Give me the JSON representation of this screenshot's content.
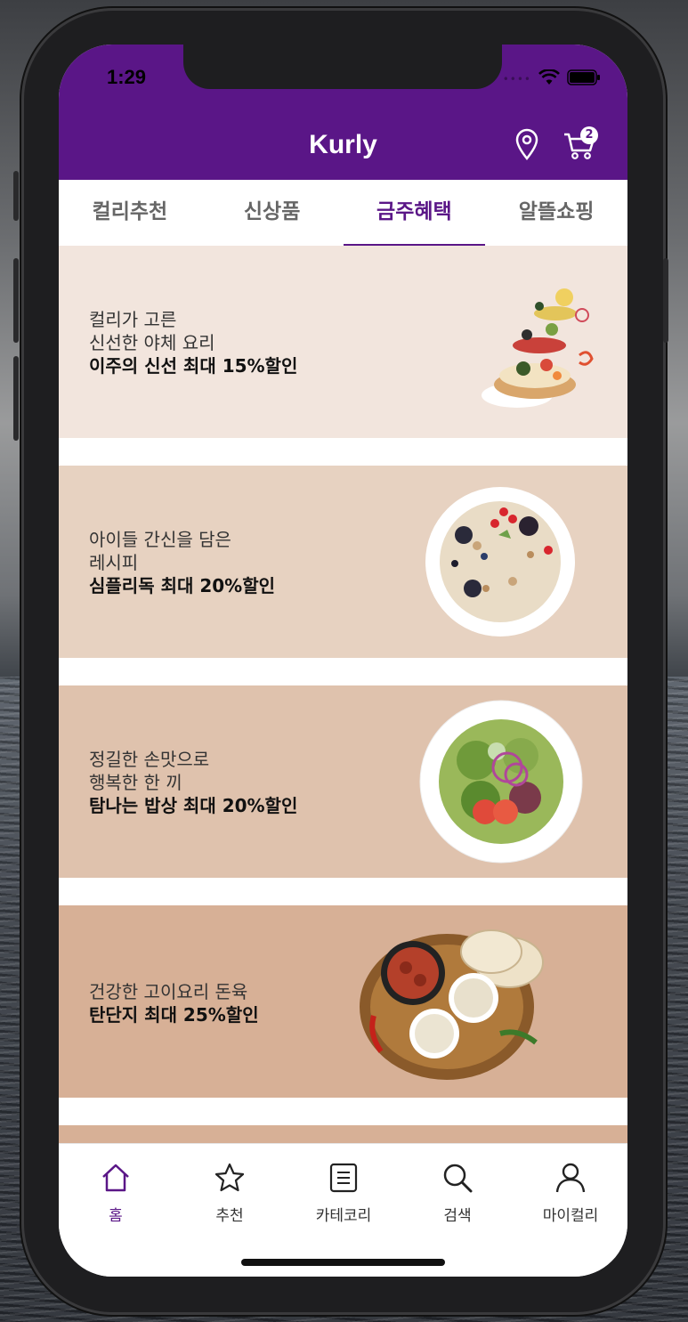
{
  "status": {
    "time": "1:29",
    "dots": "••••"
  },
  "header": {
    "title": "Kurly",
    "cart_count": "2"
  },
  "tabs": [
    {
      "label": "컬리추천",
      "active": false
    },
    {
      "label": "신상품",
      "active": false
    },
    {
      "label": "금주혜택",
      "active": true
    },
    {
      "label": "알뜰쇼핑",
      "active": false
    }
  ],
  "banners": [
    {
      "line1": "컬리가 고른",
      "line2": "신선한 야체 요리",
      "highlight": "이주의 신선 최대 15%할인",
      "bg": "#f2e5dd"
    },
    {
      "line1": "아이들 간신을 담은",
      "line2": "레시피",
      "highlight": "심플리독 최대 20%할인",
      "bg": "#e7d2c1"
    },
    {
      "line1": "정길한 손맛으로",
      "line2": "행복한 한 끼",
      "highlight": "탐나는 밥상 최대 20%할인",
      "bg": "#dfc2ad"
    },
    {
      "line1": "건강한 고이요리 돈육",
      "line2": "",
      "highlight": "탄단지 최대 25%할인",
      "bg": "#d7b096"
    }
  ],
  "bottom_nav": [
    {
      "label": "홈",
      "icon": "home-icon",
      "active": true
    },
    {
      "label": "추천",
      "icon": "star-icon",
      "active": false
    },
    {
      "label": "카테코리",
      "icon": "list-icon",
      "active": false
    },
    {
      "label": "검색",
      "icon": "search-icon",
      "active": false
    },
    {
      "label": "마이컬리",
      "icon": "person-icon",
      "active": false
    }
  ],
  "colors": {
    "brand": "#5a1687",
    "tab_inactive": "#666666"
  }
}
